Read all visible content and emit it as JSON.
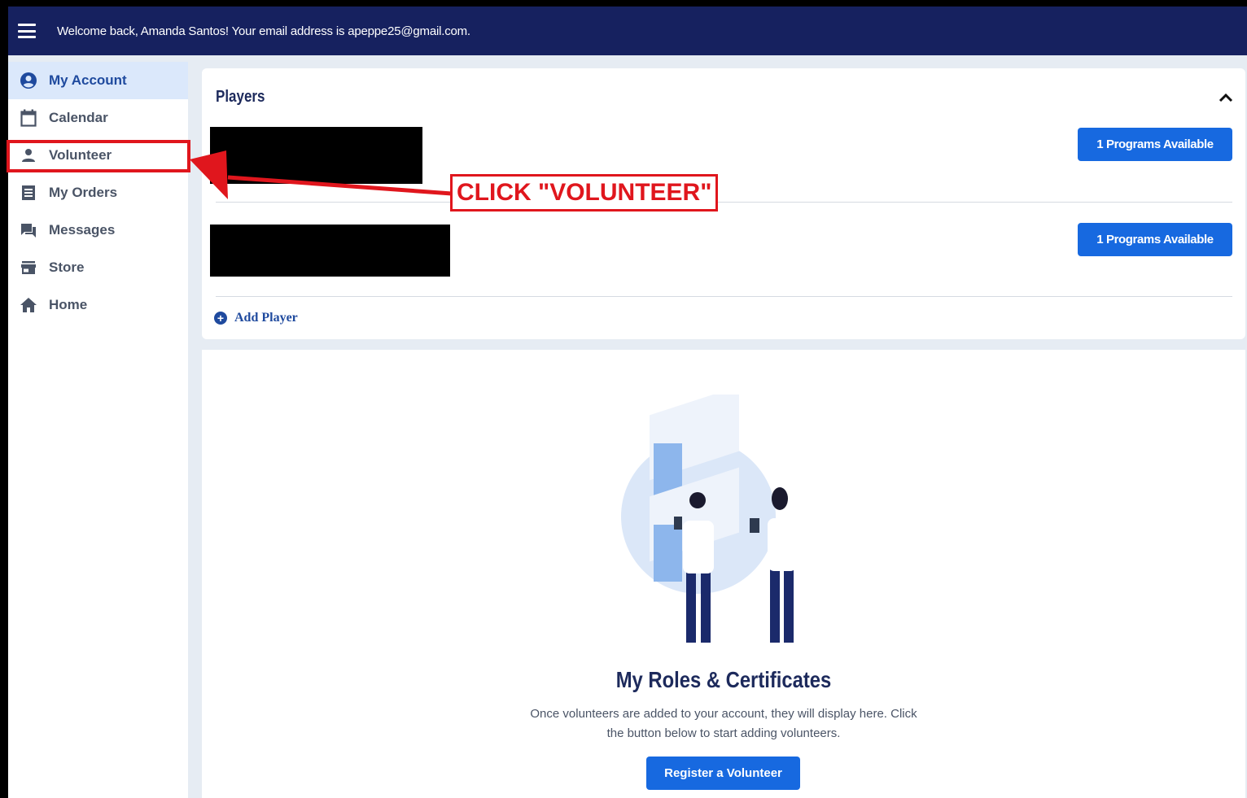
{
  "header": {
    "welcome_text": "Welcome back, Amanda Santos! Your email address is apeppe25@gmail.com."
  },
  "sidebar": {
    "items": [
      {
        "label": "My Account",
        "icon": "account-circle-icon",
        "active": true
      },
      {
        "label": "Calendar",
        "icon": "calendar-icon",
        "active": false
      },
      {
        "label": "Volunteer",
        "icon": "person-icon",
        "active": false
      },
      {
        "label": "My Orders",
        "icon": "receipt-icon",
        "active": false
      },
      {
        "label": "Messages",
        "icon": "chat-icon",
        "active": false
      },
      {
        "label": "Store",
        "icon": "store-icon",
        "active": false
      },
      {
        "label": "Home",
        "icon": "home-icon",
        "active": false
      }
    ]
  },
  "players": {
    "title": "Players",
    "rows": [
      {
        "programs_button": "1 Programs Available"
      },
      {
        "programs_button": "1 Programs Available"
      }
    ],
    "add_player_label": "Add Player"
  },
  "roles": {
    "title": "My Roles & Certificates",
    "description": "Once volunteers are added to your account, they will display here. Click the button below to start adding volunteers.",
    "register_button": "Register a Volunteer"
  },
  "annotation": {
    "label": "CLICK \"VOLUNTEER\"",
    "color": "#e0161d"
  },
  "colors": {
    "topbar": "#16215f",
    "accent": "#1769e0",
    "active_nav_bg": "#dbe8fb",
    "heading": "#1d2a5c"
  }
}
